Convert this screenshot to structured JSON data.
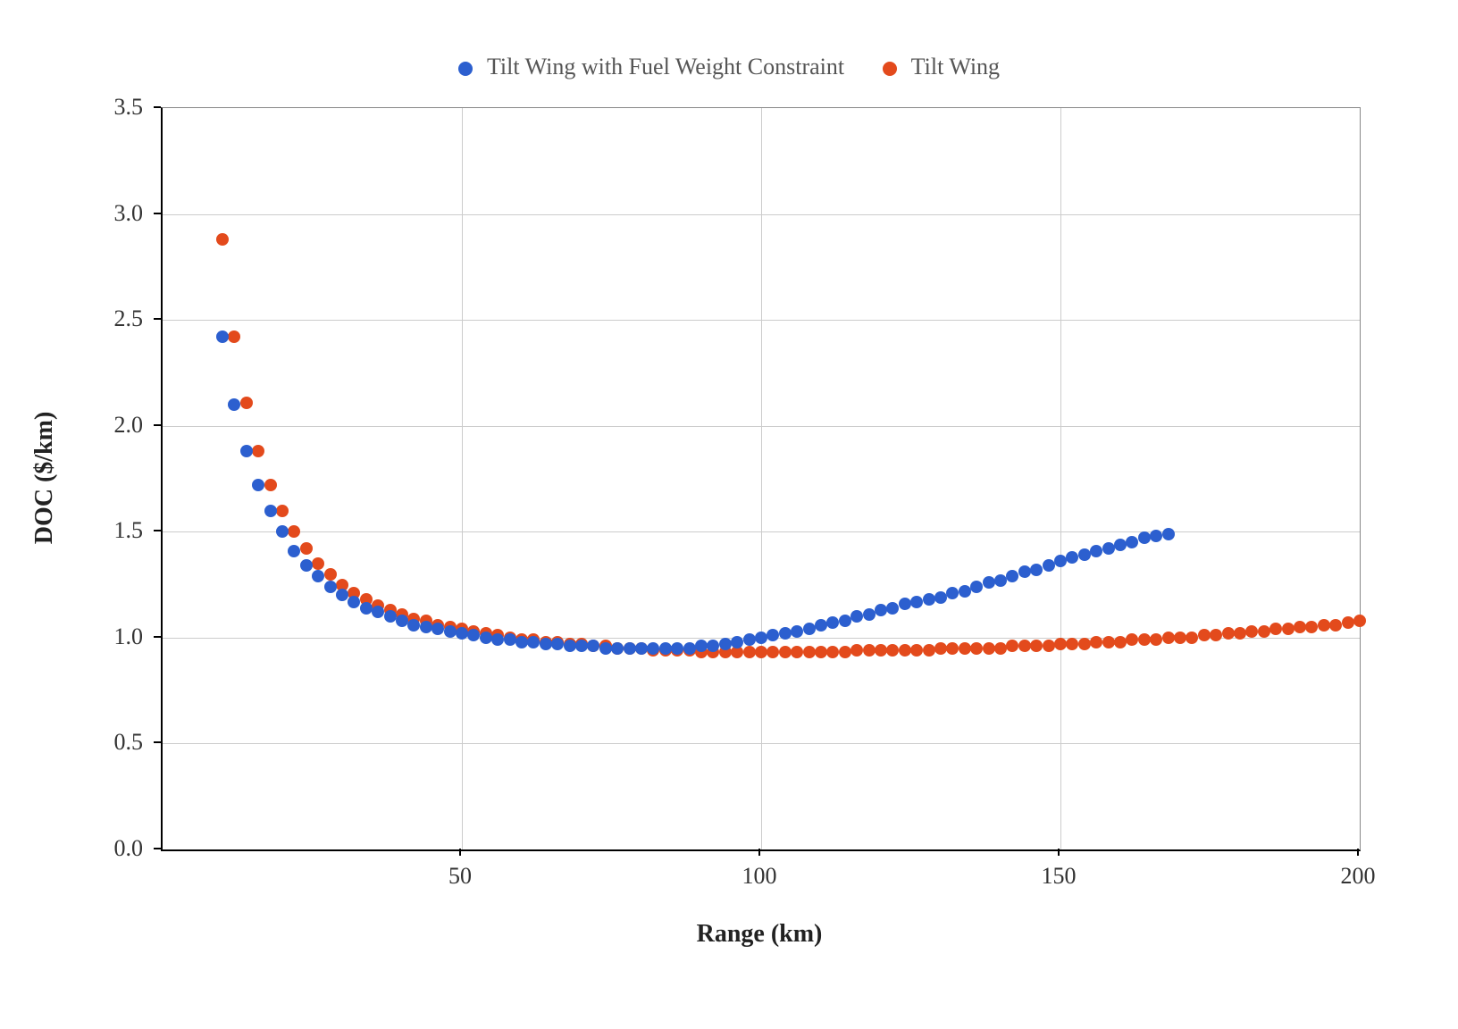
{
  "legend": {
    "series1_label": "Tilt Wing with Fuel Weight Constraint",
    "series2_label": "Tilt Wing",
    "series1_color": "#2c5fcf",
    "series2_color": "#e34a1c"
  },
  "axes": {
    "xlabel": "Range (km)",
    "ylabel": "DOC ($/km)"
  },
  "chart_data": {
    "type": "scatter",
    "xlabel": "Range (km)",
    "ylabel": "DOC ($/km)",
    "xlim": [
      0,
      200
    ],
    "ylim": [
      0,
      3.5
    ],
    "x_ticks": [
      50,
      100,
      150,
      200
    ],
    "y_ticks": [
      0.0,
      0.5,
      1.0,
      1.5,
      2.0,
      2.5,
      3.0,
      3.5
    ],
    "series": [
      {
        "name": "Tilt Wing with Fuel Weight Constraint",
        "color": "#2c5fcf",
        "x": [
          10,
          12,
          14,
          16,
          18,
          20,
          22,
          24,
          26,
          28,
          30,
          32,
          34,
          36,
          38,
          40,
          42,
          44,
          46,
          48,
          50,
          52,
          54,
          56,
          58,
          60,
          62,
          64,
          66,
          68,
          70,
          72,
          74,
          76,
          78,
          80,
          82,
          84,
          86,
          88,
          90,
          92,
          94,
          96,
          98,
          100,
          102,
          104,
          106,
          108,
          110,
          112,
          114,
          116,
          118,
          120,
          122,
          124,
          126,
          128,
          130,
          132,
          134,
          136,
          138,
          140,
          142,
          144,
          146,
          148,
          150,
          152,
          154,
          156,
          158,
          160,
          162,
          164,
          166,
          168
        ],
        "y": [
          2.42,
          2.1,
          1.88,
          1.72,
          1.6,
          1.5,
          1.41,
          1.34,
          1.29,
          1.24,
          1.2,
          1.17,
          1.14,
          1.12,
          1.1,
          1.08,
          1.06,
          1.05,
          1.04,
          1.03,
          1.02,
          1.01,
          1.0,
          0.99,
          0.99,
          0.98,
          0.98,
          0.97,
          0.97,
          0.96,
          0.96,
          0.96,
          0.95,
          0.95,
          0.95,
          0.95,
          0.95,
          0.95,
          0.95,
          0.95,
          0.96,
          0.96,
          0.97,
          0.98,
          0.99,
          1.0,
          1.01,
          1.02,
          1.03,
          1.04,
          1.06,
          1.07,
          1.08,
          1.1,
          1.11,
          1.13,
          1.14,
          1.16,
          1.17,
          1.18,
          1.19,
          1.21,
          1.22,
          1.24,
          1.26,
          1.27,
          1.29,
          1.31,
          1.32,
          1.34,
          1.36,
          1.38,
          1.39,
          1.41,
          1.42,
          1.44,
          1.45,
          1.47,
          1.48,
          1.49
        ]
      },
      {
        "name": "Tilt Wing",
        "color": "#e34a1c",
        "x": [
          10,
          12,
          14,
          16,
          18,
          20,
          22,
          24,
          26,
          28,
          30,
          32,
          34,
          36,
          38,
          40,
          42,
          44,
          46,
          48,
          50,
          52,
          54,
          56,
          58,
          60,
          62,
          64,
          66,
          68,
          70,
          72,
          74,
          76,
          78,
          80,
          82,
          84,
          86,
          88,
          90,
          92,
          94,
          96,
          98,
          100,
          102,
          104,
          106,
          108,
          110,
          112,
          114,
          116,
          118,
          120,
          122,
          124,
          126,
          128,
          130,
          132,
          134,
          136,
          138,
          140,
          142,
          144,
          146,
          148,
          150,
          152,
          154,
          156,
          158,
          160,
          162,
          164,
          166,
          168,
          170,
          172,
          174,
          176,
          178,
          180,
          182,
          184,
          186,
          188,
          190,
          192,
          194,
          196,
          198,
          200
        ],
        "y": [
          2.88,
          2.42,
          2.11,
          1.88,
          1.72,
          1.6,
          1.5,
          1.42,
          1.35,
          1.3,
          1.25,
          1.21,
          1.18,
          1.15,
          1.13,
          1.11,
          1.09,
          1.08,
          1.06,
          1.05,
          1.04,
          1.03,
          1.02,
          1.01,
          1.0,
          0.99,
          0.99,
          0.98,
          0.98,
          0.97,
          0.97,
          0.96,
          0.96,
          0.95,
          0.95,
          0.95,
          0.94,
          0.94,
          0.94,
          0.94,
          0.93,
          0.93,
          0.93,
          0.93,
          0.93,
          0.93,
          0.93,
          0.93,
          0.93,
          0.93,
          0.93,
          0.93,
          0.93,
          0.94,
          0.94,
          0.94,
          0.94,
          0.94,
          0.94,
          0.94,
          0.95,
          0.95,
          0.95,
          0.95,
          0.95,
          0.95,
          0.96,
          0.96,
          0.96,
          0.96,
          0.97,
          0.97,
          0.97,
          0.98,
          0.98,
          0.98,
          0.99,
          0.99,
          0.99,
          1.0,
          1.0,
          1.0,
          1.01,
          1.01,
          1.02,
          1.02,
          1.03,
          1.03,
          1.04,
          1.04,
          1.05,
          1.05,
          1.06,
          1.06,
          1.07,
          1.08
        ]
      }
    ]
  }
}
